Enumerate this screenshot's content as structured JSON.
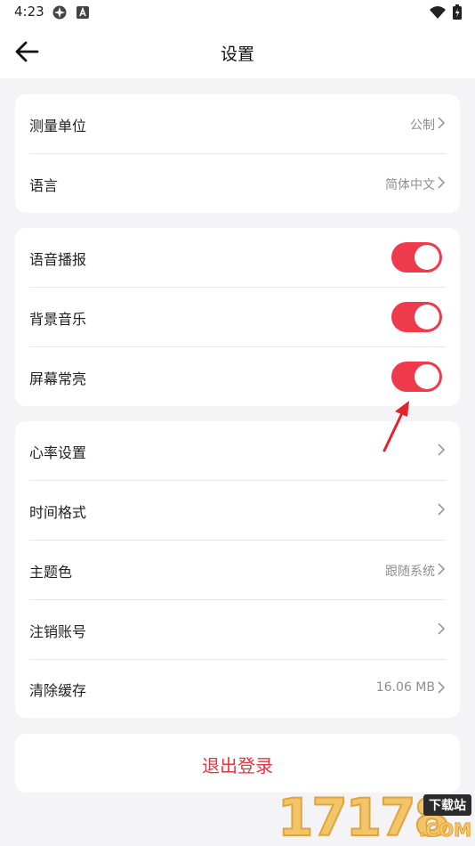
{
  "status_bar": {
    "time": "4:23"
  },
  "app_bar": {
    "title": "设置"
  },
  "group1": [
    {
      "label": "测量单位",
      "value": "公制"
    },
    {
      "label": "语言",
      "value": "简体中文"
    }
  ],
  "group2": [
    {
      "label": "语音播报",
      "enabled": true
    },
    {
      "label": "背景音乐",
      "enabled": true
    },
    {
      "label": "屏幕常亮",
      "enabled": true
    }
  ],
  "group3": [
    {
      "label": "心率设置",
      "value": ""
    },
    {
      "label": "时间格式",
      "value": ""
    },
    {
      "label": "主题色",
      "value": "跟随系统"
    },
    {
      "label": "注销账号",
      "value": ""
    },
    {
      "label": "清除缓存",
      "value": "16.06 MB"
    }
  ],
  "logout": {
    "label": "退出登录"
  },
  "watermark": {
    "number": "17178",
    "badge": "下载站",
    "domain": ".COM"
  },
  "colors": {
    "accent": "#ee3a4a",
    "logout": "#e8343f",
    "background": "#f4f4f6"
  },
  "icons": [
    "back-arrow-icon",
    "chevron-right-icon",
    "wifi-icon",
    "battery-icon",
    "annotation-arrow-icon"
  ]
}
